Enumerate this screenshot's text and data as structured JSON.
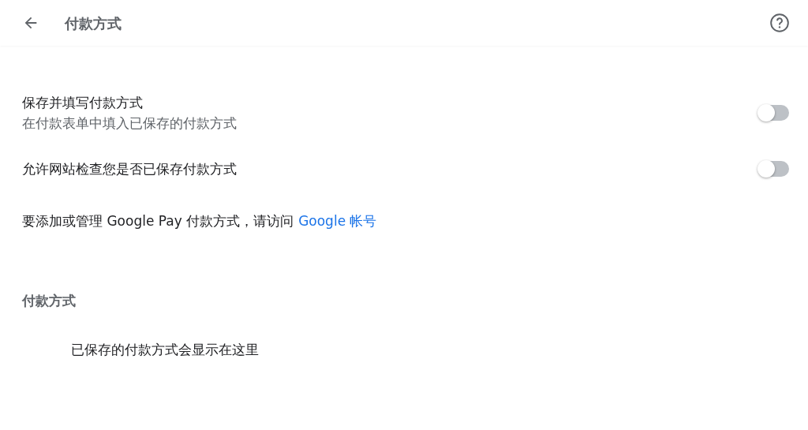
{
  "header": {
    "title": "付款方式"
  },
  "settings": [
    {
      "label": "保存并填写付款方式",
      "description": "在付款表单中填入已保存的付款方式",
      "on": false
    },
    {
      "label": "允许网站检查您是否已保存付款方式",
      "on": false
    }
  ],
  "notice": {
    "text": "要添加或管理 Google Pay 付款方式，请访问",
    "link": "Google 帐号"
  },
  "section": {
    "title": "付款方式",
    "empty_text": "已保存的付款方式会显示在这里"
  }
}
